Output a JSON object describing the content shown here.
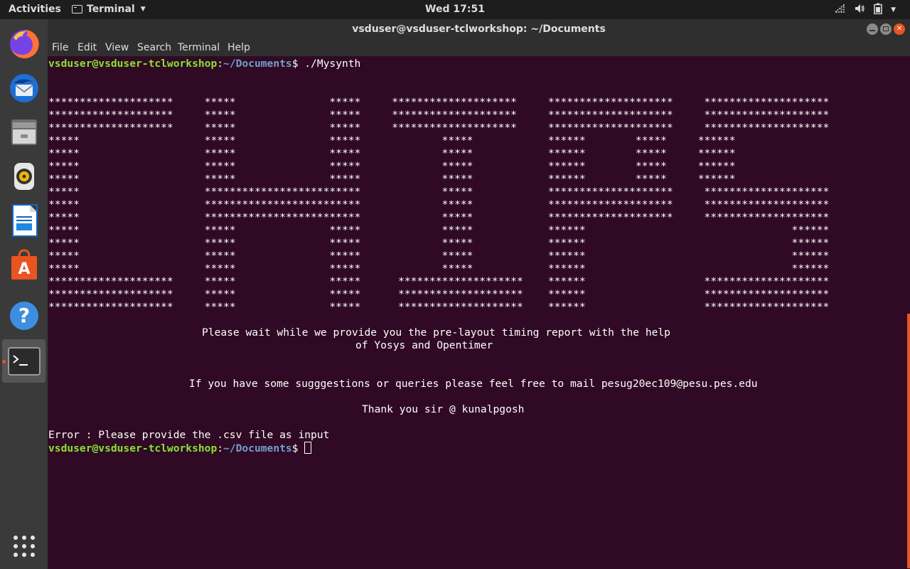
{
  "topbar": {
    "activities": "Activities",
    "app_name": "Terminal",
    "clock": "Wed 17:51"
  },
  "dock": {
    "items": [
      "firefox",
      "thunderbird",
      "files",
      "rhythmbox",
      "libreoffice-writer",
      "ubuntu-software",
      "help",
      "terminal",
      "show-applications"
    ]
  },
  "window": {
    "title": "vsduser@vsduser-tclworkshop: ~/Documents",
    "menu": [
      "File",
      "Edit",
      "View",
      "Search",
      "Terminal",
      "Help"
    ]
  },
  "terminal": {
    "prompt_user": "vsduser@vsduser-tclworkshop",
    "prompt_path": "~/Documents",
    "command1": " ./Mysynth",
    "art": [
      "********************     *****               *****     ********************     ********************     ********************",
      "********************     *****               *****     ********************     ********************     ********************",
      "********************     *****               *****     ********************     ********************     ********************",
      "*****                    *****               *****             *****            ******        *****     ******",
      "*****                    *****               *****             *****            ******        *****     ******",
      "*****                    *****               *****             *****            ******        *****     ******",
      "*****                    *****               *****             *****            ******        *****     ******",
      "*****                    *************************             *****            ********************     ********************",
      "*****                    *************************             *****            ********************     ********************",
      "*****                    *************************             *****            ********************     ********************",
      "*****                    *****               *****             *****            ******                                 ******",
      "*****                    *****               *****             *****            ******                                 ******",
      "*****                    *****               *****             *****            ******                                 ******",
      "*****                    *****               *****             *****            ******                                 ******",
      "********************     *****               *****      ********************    ******                   ********************",
      "********************     *****               *****      ********************    ******                   ********************",
      "********************     *****               *****      ********************    ******                   ********************"
    ],
    "wait_line1": "Please wait while we provide you the pre-layout timing report with the help",
    "wait_line2": "of Yosys and Opentimer",
    "suggest_line": "If you have some sugggestions or queries please feel free to mail pesug20ec109@pesu.pes.edu",
    "thanks_line": "Thank you sir @ kunalpgosh",
    "error_line": "Error : Please provide the .csv file as input"
  },
  "colors": {
    "terminal_bg": "#300a24",
    "prompt_user": "#8ae234",
    "prompt_path": "#729fcf",
    "accent": "#e95420"
  }
}
